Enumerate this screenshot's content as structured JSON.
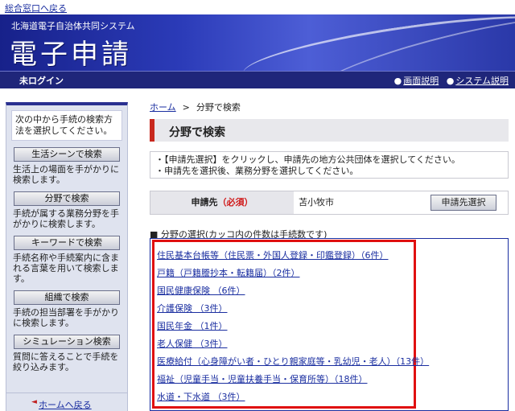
{
  "top": {
    "back_link": "総合窓口へ戻る"
  },
  "header": {
    "subtitle": "北海道電子自治体共同システム",
    "title": "電子申請"
  },
  "statusbar": {
    "login_status": "未ログイン",
    "links": [
      "画面説明",
      "システム説明"
    ],
    "bullet": "●"
  },
  "sidebar": {
    "intro": "次の中から手続の検索方法を選択してください。",
    "items": [
      {
        "button": "生活シーンで検索",
        "desc": "生活上の場面を手がかりに検索します。"
      },
      {
        "button": "分野で検索",
        "desc": "手続が属する業務分野を手がかりに検索します。"
      },
      {
        "button": "キーワードで検索",
        "desc": "手続名称や手続案内に含まれる言葉を用いて検索します。"
      },
      {
        "button": "組織で検索",
        "desc": "手続の担当部署を手がかりに検索します。"
      },
      {
        "button": "シミュレーション検索",
        "desc": "質問に答えることで手続を絞り込みます。"
      }
    ],
    "home_arrow": "◄",
    "home_link": "ホームへ戻る"
  },
  "main": {
    "breadcrumb": {
      "home": "ホーム",
      "sep": ">",
      "current": "分野で検索"
    },
    "page_title": "分野で検索",
    "notice_lines": [
      "・【申請先選択】をクリックし、申請先の地方公共団体を選択してください。",
      "・申請先を選択後、業務分野を選択してください。"
    ],
    "applicant": {
      "label": "申請先",
      "required": "（必須）",
      "value": "苫小牧市",
      "select_button": "申請先選択"
    },
    "field_title": "■ 分野の選択(カッコ内の件数は手続数です)",
    "fields": [
      "住民基本台帳等（住民票・外国人登録・印鑑登録）（6件）",
      "戸籍（戸籍謄抄本・転籍届）（2件）",
      "国民健康保険 （6件）",
      "介護保険 （3件）",
      "国民年金 （1件）",
      "老人保健 （3件）",
      "医療給付（心身障がい者・ひとり親家庭等・乳幼児・老人）（13件）",
      "福祉（児童手当・児童扶養手当・保育所等）（18件）",
      "水道・下水道 （3件）"
    ]
  },
  "colors": {
    "header_blue": "#2b3bb8",
    "nav_navy": "#1f267a",
    "accent_red": "#c8281e",
    "link_blue": "#1a2ea0"
  }
}
